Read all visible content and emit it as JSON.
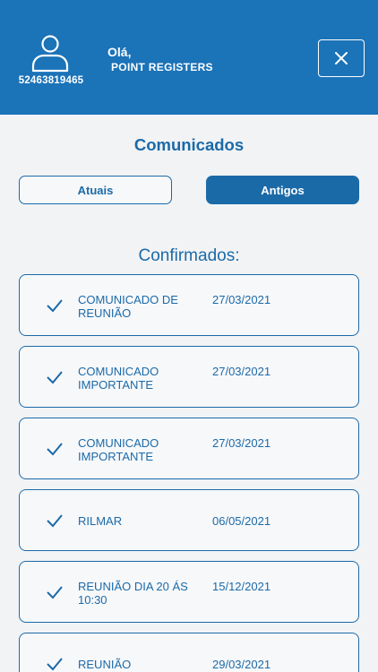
{
  "header": {
    "user_id": "52463819465",
    "greeting": "Olá,",
    "name": "POINT REGISTERS",
    "avatar_icon": "user-icon",
    "close_icon": "close-icon",
    "background_color": "#1b73b8"
  },
  "page_title": "Comunicados",
  "tabs": [
    {
      "label": "Atuais",
      "selected": false
    },
    {
      "label": "Antigos",
      "selected": true
    }
  ],
  "section_title": "Confirmados:",
  "items": [
    {
      "title": "COMUNICADO DE REUNIÃO",
      "date": "27/03/2021",
      "status_icon": "check-icon"
    },
    {
      "title": "COMUNICADO IMPORTANTE",
      "date": "27/03/2021",
      "status_icon": "check-icon"
    },
    {
      "title": "COMUNICADO IMPORTANTE",
      "date": "27/03/2021",
      "status_icon": "check-icon"
    },
    {
      "title": "RILMAR",
      "date": "06/05/2021",
      "status_icon": "check-icon"
    },
    {
      "title": "REUNIÃO DIA 20 ÁS 10:30",
      "date": "15/12/2021",
      "status_icon": "check-icon"
    },
    {
      "title": "REUNIÃO",
      "date": "29/03/2021",
      "status_icon": "check-icon"
    }
  ],
  "colors": {
    "accent": "#1b6aa8",
    "background": "#f2f3f5"
  }
}
